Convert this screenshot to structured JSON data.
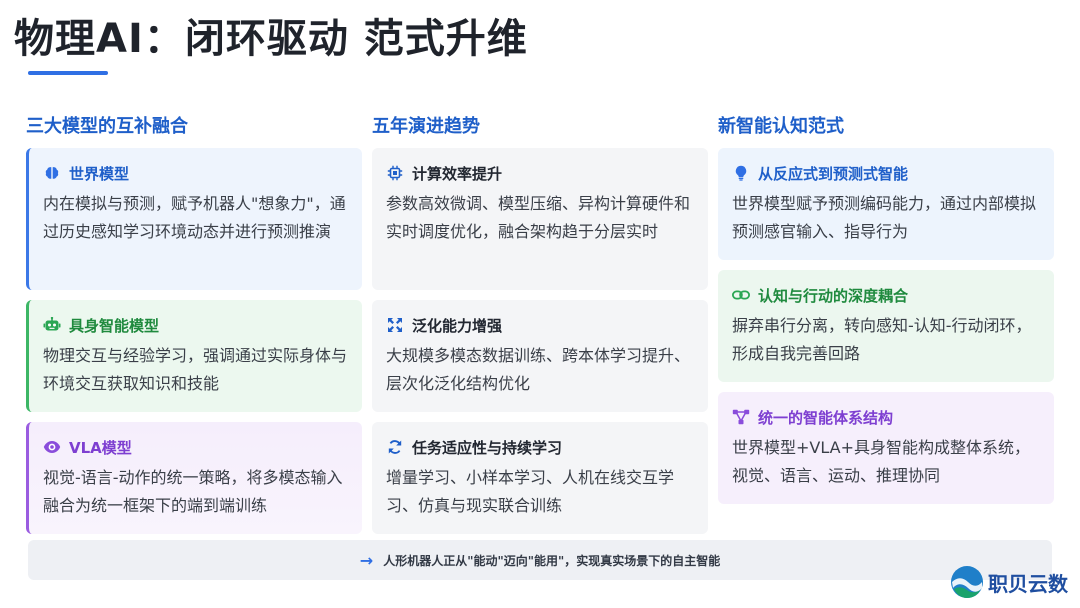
{
  "title": "物理AI：闭环驱动 范式升维",
  "columns": [
    {
      "heading": "三大模型的互补融合",
      "cards": [
        {
          "icon": "brain-icon",
          "title": "世界模型",
          "body": "内在模拟与预测，赋予机器人\"想象力\"，通过历史感知学习环境动态并进行预测推演"
        },
        {
          "icon": "robot-icon",
          "title": "具身智能模型",
          "body": "物理交互与经验学习，强调通过实际身体与环境交互获取知识和技能"
        },
        {
          "icon": "eye-icon",
          "title": "VLA模型",
          "body": "视觉-语言-动作的统一策略，将多模态输入融合为统一框架下的端到端训练"
        }
      ]
    },
    {
      "heading": "五年演进趋势",
      "cards": [
        {
          "icon": "chip-icon",
          "title": "计算效率提升",
          "body": "参数高效微调、模型压缩、异构计算硬件和实时调度优化，融合架构趋于分层实时"
        },
        {
          "icon": "expand-icon",
          "title": "泛化能力增强",
          "body": "大规模多模态数据训练、跨本体学习提升、层次化泛化结构优化"
        },
        {
          "icon": "refresh-icon",
          "title": "任务适应性与持续学习",
          "body": "增量学习、小样本学习、人机在线交互学习、仿真与现实联合训练"
        }
      ]
    },
    {
      "heading": "新智能认知范式",
      "cards": [
        {
          "icon": "lightbulb-icon",
          "title": "从反应式到预测式智能",
          "body": "世界模型赋予预测编码能力，通过内部模拟预测感官输入、指导行为"
        },
        {
          "icon": "link-icon",
          "title": "认知与行动的深度耦合",
          "body": "摒弃串行分离，转向感知-认知-行动闭环，形成自我完善回路"
        },
        {
          "icon": "network-icon",
          "title": "统一的智能体系结构",
          "body": "世界模型+VLA+具身智能构成整体系统，视觉、语言、运动、推理协同"
        }
      ]
    }
  ],
  "footer": {
    "icon": "arrow-right-icon",
    "text": "人形机器人正从\"能动\"迈向\"能用\"，实现真实场景下的自主智能"
  },
  "logo": {
    "text": "职贝云数"
  },
  "colors": {
    "accent_blue": "#2f6fe4",
    "heading_blue": "#1f5fc9",
    "green": "#1f8a3e",
    "purple": "#7e3fd1"
  }
}
